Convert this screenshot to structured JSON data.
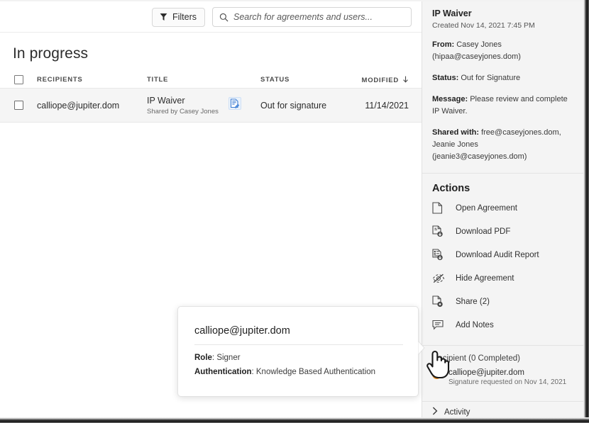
{
  "toolbar": {
    "filters_label": "Filters",
    "filter_icon": "funnel-icon",
    "search_icon": "search-icon",
    "search_placeholder": "Search for agreements and users...",
    "search_value": ""
  },
  "main": {
    "page_title": "In progress",
    "table": {
      "columns": [
        "RECIPIENTS",
        "TITLE",
        "STATUS",
        "MODIFIED"
      ],
      "sort_column": "MODIFIED",
      "sort_direction": "down",
      "rows": [
        {
          "recipient": "calliope@jupiter.dom",
          "title": "IP Waiver",
          "shared_by": "Shared by Casey Jones",
          "doc_icon": "document-signature-icon",
          "status": "Out for signature",
          "modified": "11/14/2021",
          "selected": false
        }
      ]
    }
  },
  "tooltip": {
    "title": "calliope@jupiter.dom",
    "role_label": "Role",
    "role_value": "Signer",
    "auth_label": "Authentication",
    "auth_value": "Knowledge Based Authentication"
  },
  "right_panel": {
    "doc_title": "IP Waiver",
    "created": "Created Nov 14, 2021 7:45 PM",
    "from_label": "From:",
    "from_value": "Casey Jones (hipaa@caseyjones.dom)",
    "status_label": "Status:",
    "status_value": "Out for Signature",
    "message_label": "Message:",
    "message_value": "Please review and complete IP Waiver.",
    "shared_label": "Shared with:",
    "shared_value": "free@caseyjones.dom, Jeanie Jones (jeanie3@caseyjones.dom)",
    "actions_heading": "Actions",
    "actions": [
      {
        "label": "Open Agreement",
        "icon": "file-icon"
      },
      {
        "label": "Download PDF",
        "icon": "download-pdf-icon"
      },
      {
        "label": "Download Audit Report",
        "icon": "download-audit-report-icon"
      },
      {
        "label": "Hide Agreement",
        "icon": "eye-slash-icon"
      },
      {
        "label": "Share (2)",
        "icon": "share-file-icon"
      },
      {
        "label": "Add Notes",
        "icon": "comment-icon"
      }
    ],
    "recipient_heading": "Recipient (0 Completed)",
    "recipient_name": "calliope@jupiter.dom",
    "recipient_sub": "Signature requested on Nov 14, 2021",
    "recipient_status_color": "#ef8f1c",
    "activity_label": "Activity",
    "activity_icon": "chevron-right-icon",
    "activity_expanded": false
  }
}
